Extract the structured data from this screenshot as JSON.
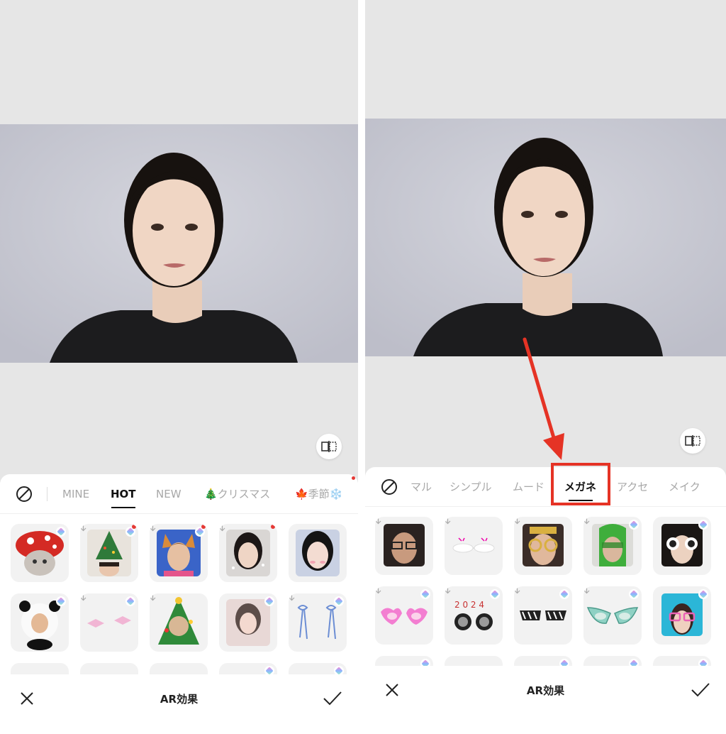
{
  "left": {
    "tabs": [
      {
        "label": "MINE",
        "active": false
      },
      {
        "label": "HOT",
        "active": true
      },
      {
        "label": "NEW",
        "active": false
      },
      {
        "label": "🎄クリスマス",
        "active": false
      },
      {
        "label": "🍁季節❄️",
        "active": false
      }
    ],
    "title": "AR効果",
    "icons": {
      "none": "none-icon",
      "compare": "compare-icon",
      "close": "close-icon",
      "confirm": "check-icon"
    }
  },
  "right": {
    "tabs": [
      {
        "label": "マル",
        "active": false
      },
      {
        "label": "シンプル",
        "active": false
      },
      {
        "label": "ムード",
        "active": false
      },
      {
        "label": "メガネ",
        "active": true
      },
      {
        "label": "アクセ",
        "active": false
      },
      {
        "label": "メイク",
        "active": false
      }
    ],
    "title": "AR効果",
    "icons": {
      "none": "none-icon",
      "compare": "compare-icon",
      "close": "close-icon",
      "confirm": "check-icon"
    }
  },
  "annotation": {
    "color": "#e53325"
  },
  "colors": {
    "preview_bg": "#e6e6e6",
    "photo_bg": "#c9cad4",
    "active_tab": "#111111",
    "inactive_tab": "#a8a8a8",
    "badge_dot": "#e53935"
  }
}
